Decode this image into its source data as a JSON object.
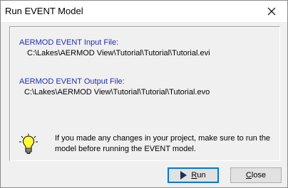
{
  "window": {
    "title": "Run EVENT Model"
  },
  "panel": {
    "input_label": "AERMOD EVENT Input File:",
    "input_path": "C:\\Lakes\\AERMOD View\\Tutorial\\Tutorial\\Tutorial.evi",
    "output_label": "AERMOD EVENT Output File:",
    "output_path": "C:\\Lakes\\AERMOD View\\Tutorial\\Tutorial\\Tutorial.evo",
    "message": "If you made any changes in your project, make sure to run the model before running the EVENT model."
  },
  "buttons": {
    "run_label_first": "R",
    "run_label_rest": "un",
    "close_label_first": "C",
    "close_label_rest": "lose"
  },
  "icons": {
    "close": "close-icon",
    "run": "play-arrow-icon",
    "hint": "lightbulb-icon"
  },
  "colors": {
    "label_blue": "#1f2db5",
    "default_button_border": "#0078d7"
  }
}
